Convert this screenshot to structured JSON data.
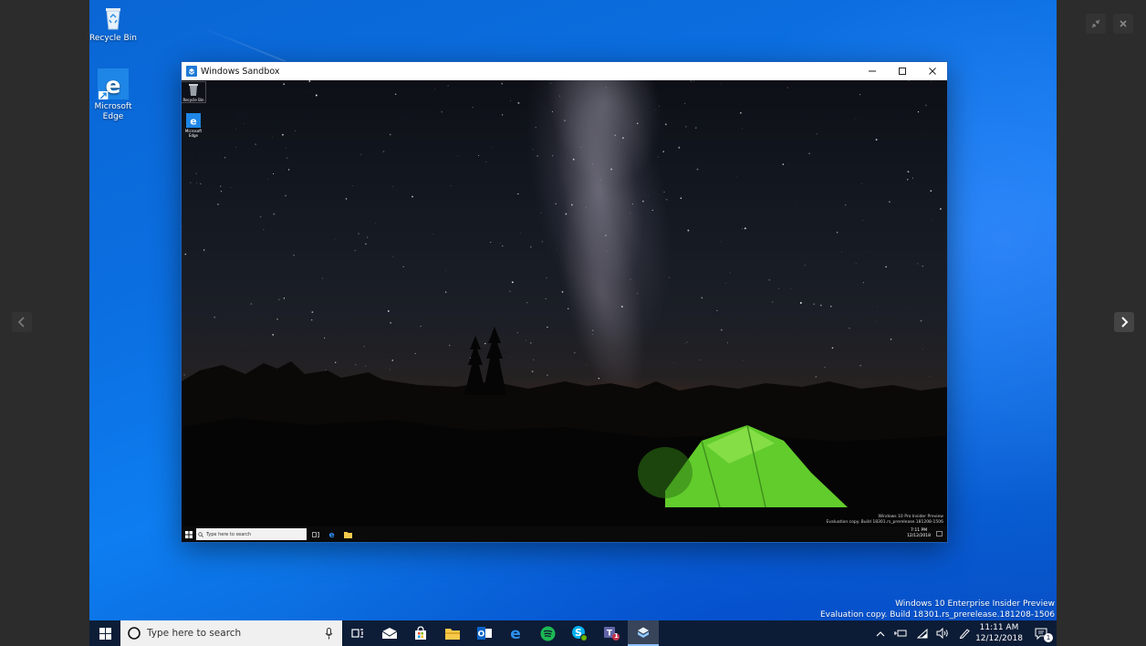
{
  "host_desktop": {
    "icons": [
      {
        "label": "Recycle Bin",
        "icon": "recycle-bin-icon"
      },
      {
        "label": "Microsoft Edge",
        "icon": "edge-icon"
      }
    ],
    "watermark": {
      "line1": "Windows 10 Enterprise Insider Preview",
      "line2": "Evaluation copy. Build 18301.rs_prerelease.181208-1506"
    }
  },
  "sandbox_window": {
    "title": "Windows Sandbox",
    "icons": [
      {
        "label": "Recycle Bin",
        "icon": "recycle-bin-icon"
      },
      {
        "label": "Microsoft Edge",
        "icon": "edge-icon"
      }
    ],
    "taskbar": {
      "search_placeholder": "Type here to search",
      "time": "7:11 PM",
      "date": "12/12/2018"
    },
    "watermark": {
      "line1": "Windows 10 Pro Insider Preview",
      "line2": "Evaluation copy. Build 18301.rs_prerelease.181208-1506"
    }
  },
  "taskbar": {
    "search_placeholder": "Type here to search",
    "apps": [
      "task-view",
      "mail",
      "store",
      "file-explorer",
      "outlook",
      "edge",
      "spotify",
      "skype",
      "teams",
      "windows-sandbox"
    ],
    "teams_badge": "1",
    "time": "11:11 AM",
    "date": "12/12/2018",
    "notification_count": "1"
  },
  "colors": {
    "desktop_blue": "#0b6ee0",
    "taskbar": "#0e1a30",
    "accent": "#0078d7"
  }
}
